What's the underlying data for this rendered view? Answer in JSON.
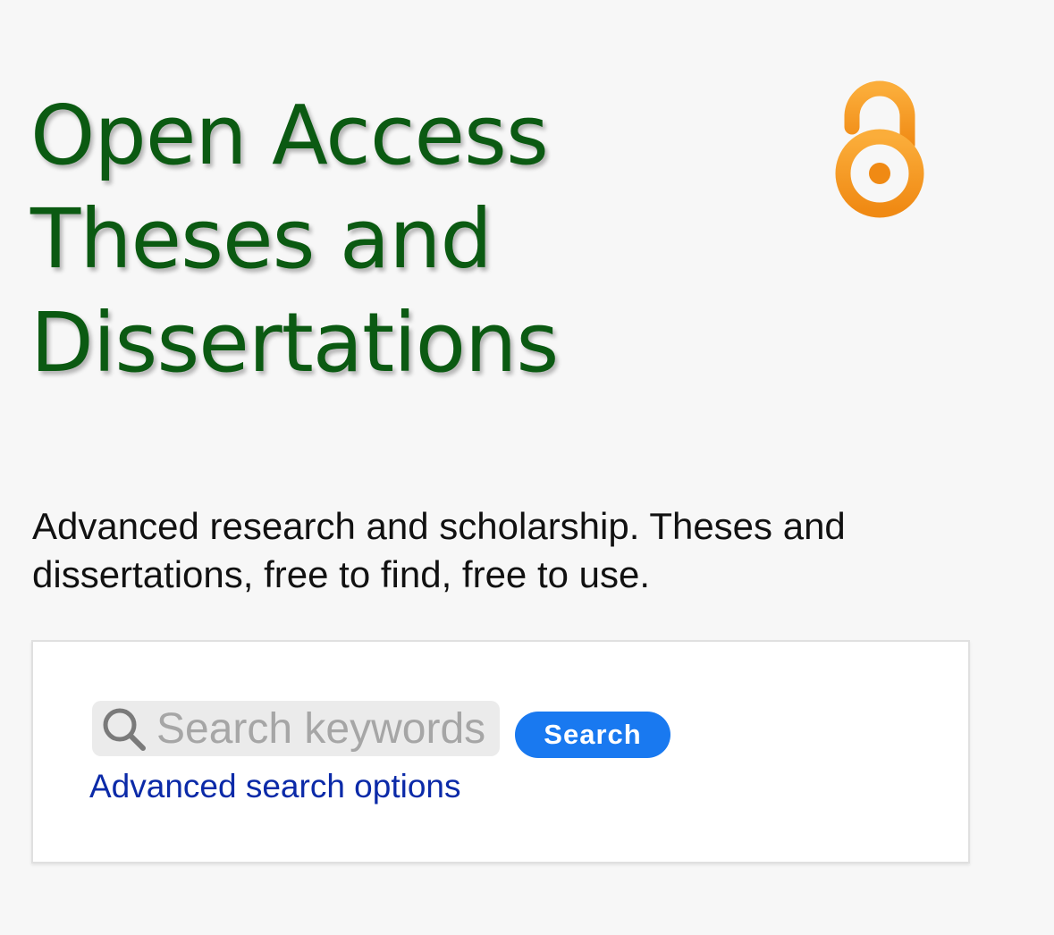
{
  "header": {
    "title_lines": [
      "Open Access",
      "Theses and",
      "Dissertations"
    ],
    "logo_icon": "open-access-lock-icon",
    "title_color": "#0b5a12",
    "logo_color": "#f7941d"
  },
  "tagline": "Advanced research and scholarship. Theses and dissertations, free to find, free to use.",
  "search": {
    "icon": "search-icon",
    "placeholder": "Search keywords",
    "value": "",
    "button_label": "Search",
    "button_color": "#1979f0",
    "advanced_link": "Advanced search options",
    "link_color": "#0b2aa8"
  }
}
